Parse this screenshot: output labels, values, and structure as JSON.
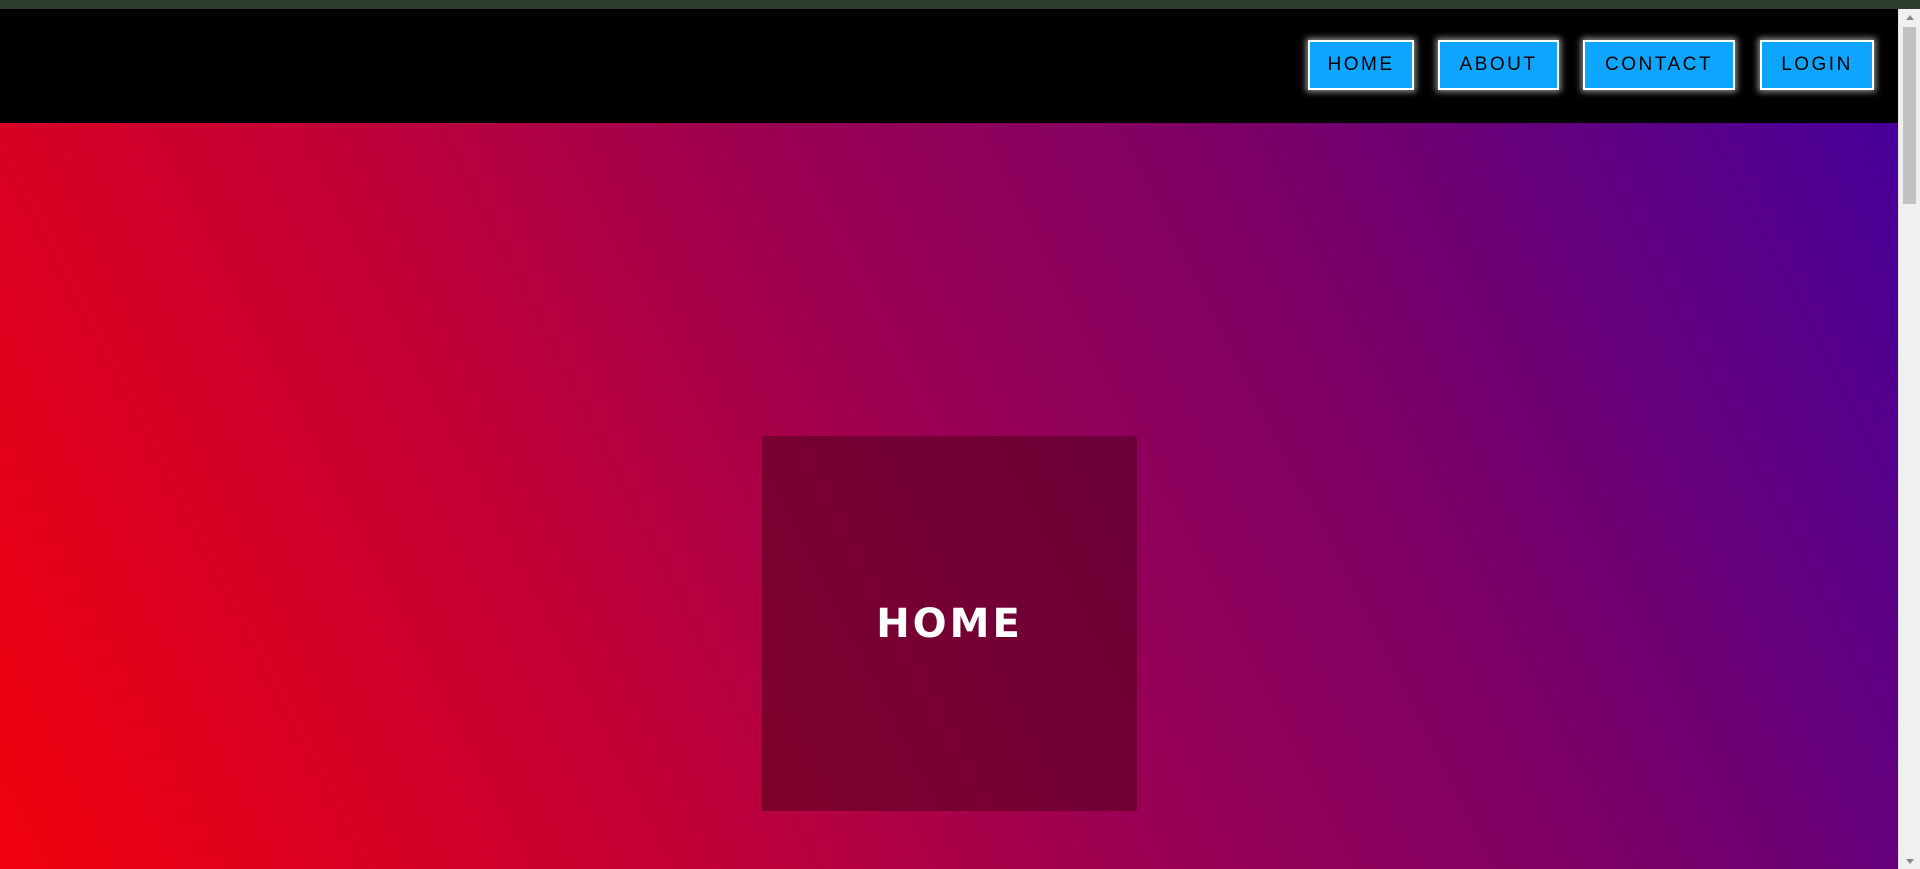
{
  "nav": {
    "home_label": "HOME",
    "about_label": "ABOUT",
    "contact_label": "CONTACT",
    "login_label": "LOGIN"
  },
  "hero": {
    "card_title": "HOME"
  },
  "colors": {
    "top_strip": "#2e3e2e",
    "navbar_bg": "#000000",
    "button_bg": "#0ea5ff",
    "button_border": "#ffffff",
    "gradient_start": "#f0000c",
    "gradient_end": "#470099",
    "card_text": "#ffffff"
  },
  "icons": {
    "scroll_up": "arrow-up-icon",
    "scroll_down": "arrow-down-icon"
  }
}
